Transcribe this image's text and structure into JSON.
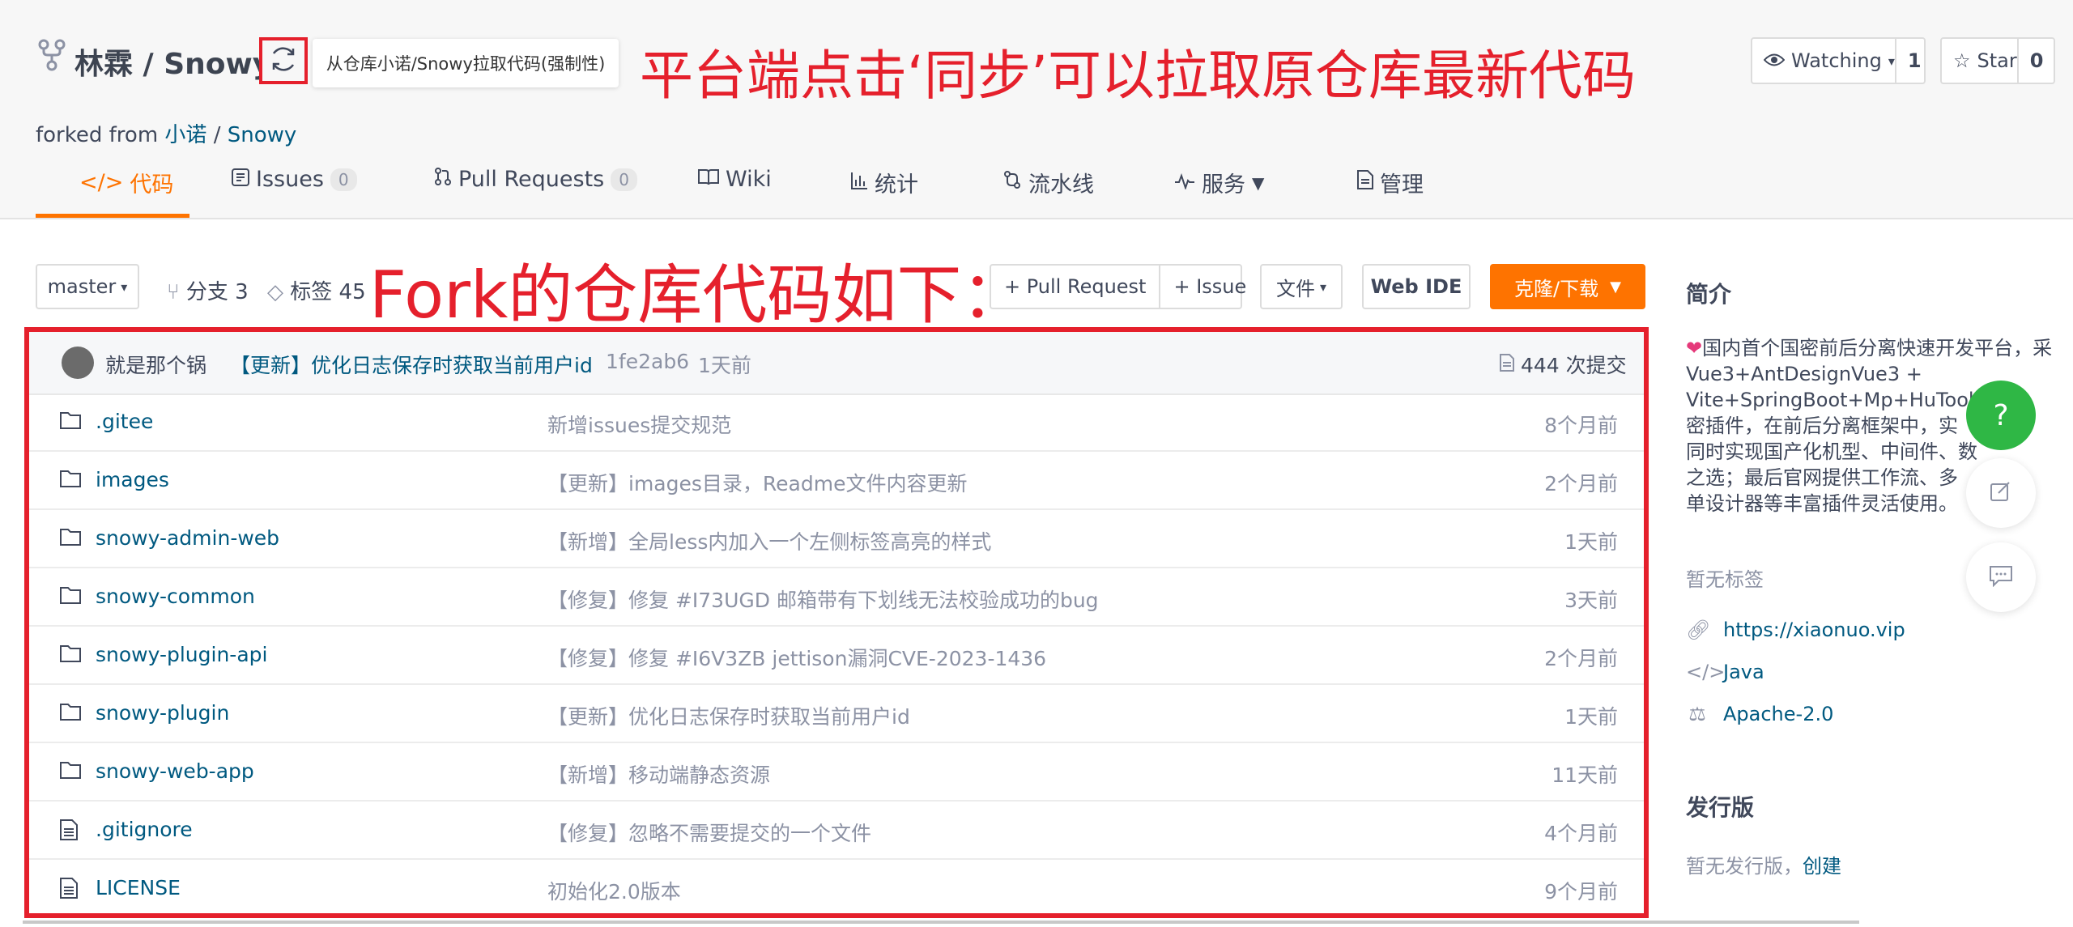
{
  "repo": {
    "owner": "林霖",
    "separator": " / ",
    "name": "Snowy",
    "sync_tooltip": "从仓库小诺/Snowy拉取代码(强制性)",
    "forked_prefix": "forked from ",
    "forked_owner": "小诺",
    "forked_sep": " / ",
    "forked_repo": "Snowy"
  },
  "annotations": {
    "top": "平台端点击‘同步’可以拉取原仓库最新代码",
    "middle": "Fork的仓库代码如下："
  },
  "header_actions": {
    "watch_label": "Watching",
    "watch_count": "1",
    "star_label": "Star",
    "star_count": "0"
  },
  "tabs": [
    {
      "label": "代码"
    },
    {
      "label": "Issues",
      "badge": "0"
    },
    {
      "label": "Pull Requests",
      "badge": "0"
    },
    {
      "label": "Wiki"
    },
    {
      "label": "统计"
    },
    {
      "label": "流水线"
    },
    {
      "label": "服务"
    },
    {
      "label": "管理"
    }
  ],
  "toolbar": {
    "branch": "master",
    "branches": "分支 3",
    "tags": "标签 45",
    "pull_request": "+ Pull Request",
    "issue": "+ Issue",
    "files": "文件",
    "web_ide": "Web IDE",
    "clone": "克隆/下载"
  },
  "latest_commit": {
    "author": "就是那个锅",
    "message": "【更新】优化日志保存时获取当前用户id",
    "hash": "1fe2ab6",
    "time": "1天前",
    "total": "444 次提交"
  },
  "files": [
    {
      "name": ".gitee",
      "type": "folder",
      "message": "新增issues提交规范",
      "time": "8个月前"
    },
    {
      "name": "images",
      "type": "folder",
      "message": "【更新】images目录，Readme文件内容更新",
      "time": "2个月前"
    },
    {
      "name": "snowy-admin-web",
      "type": "folder",
      "message": "【新增】全局less内加入一个左侧标签高亮的样式",
      "time": "1天前"
    },
    {
      "name": "snowy-common",
      "type": "folder",
      "message": "【修复】修复 #I73UGD 邮箱带有下划线无法校验成功的bug",
      "time": "3天前"
    },
    {
      "name": "snowy-plugin-api",
      "type": "folder",
      "message": "【修复】修复 #I6V3ZB jettison漏洞CVE-2023-1436",
      "time": "2个月前"
    },
    {
      "name": "snowy-plugin",
      "type": "folder",
      "message": "【更新】优化日志保存时获取当前用户id",
      "time": "1天前"
    },
    {
      "name": "snowy-web-app",
      "type": "folder",
      "message": "【新增】移动端静态资源",
      "time": "11天前"
    },
    {
      "name": ".gitignore",
      "type": "file",
      "message": "【修复】忽略不需要提交的一个文件",
      "time": "4个月前"
    },
    {
      "name": "LICENSE",
      "type": "file",
      "message": "初始化2.0版本",
      "time": "9个月前"
    }
  ],
  "sidebar": {
    "intro_title": "简介",
    "description_lines": [
      "国内首个国密前后分离快速开发平台，采",
      "Vue3+AntDesignVue3 +",
      "Vite+SpringBoot+Mp+HuTool+",
      "密插件，在前后分离框架中，实",
      "同时实现国产化机型、中间件、数",
      "之选；最后官网提供工作流、多",
      "单设计器等丰富插件灵活使用。"
    ],
    "no_tags": "暂无标签",
    "website": "https://xiaonuo.vip",
    "language": "Java",
    "license": "Apache-2.0",
    "release_title": "发行版",
    "no_release": "暂无发行版，",
    "create": "创建"
  },
  "float": {
    "help": "?"
  },
  "colors": {
    "accent_orange": "#fe7300",
    "annotation_red": "#e5202c",
    "link_blue": "#005980",
    "help_green": "#2fb745"
  }
}
